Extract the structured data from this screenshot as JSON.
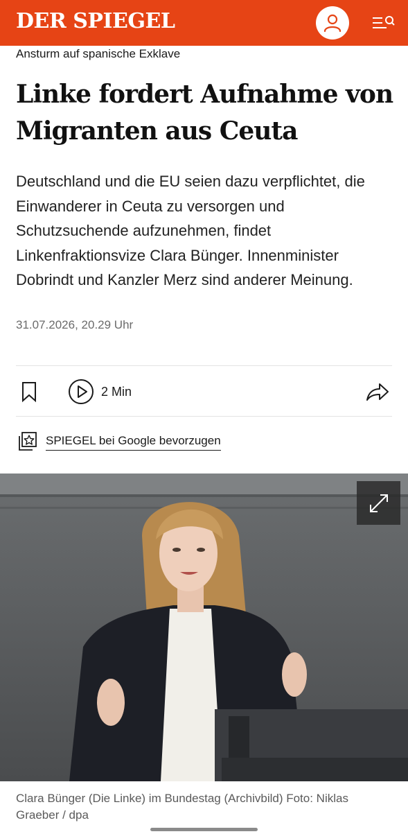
{
  "header": {
    "logo_text": "DER SPIEGEL",
    "brand_color": "#e64415",
    "account_icon": "user-icon",
    "menu_icon": "menu-search-icon"
  },
  "article": {
    "kicker": "Ansturm auf spanische Exklave",
    "headline": "Linke fordert Aufnahme von Migranten aus Ceuta",
    "intro": "Deutschland und die EU seien dazu verpflichtet, die Einwanderer in Ceuta zu versorgen und Schutzsuchende aufzunehmen, findet Linkenfraktionsvize Clara Bünger. Innenminister Dobrindt und Kanzler Merz sind anderer Meinung.",
    "date": "31.07.2026, 20.29 Uhr"
  },
  "actions": {
    "bookmark_icon": "bookmark-icon",
    "play_icon": "play-icon",
    "duration": "2 Min",
    "share_icon": "share-icon"
  },
  "google": {
    "icon": "google-star-icon",
    "label": "SPIEGEL bei Google bevorzugen"
  },
  "image": {
    "expand_icon": "expand-icon",
    "caption": "Clara Bünger (Die Linke) im Bundestag (Archivbild)  Foto: Niklas Graeber / dpa"
  }
}
